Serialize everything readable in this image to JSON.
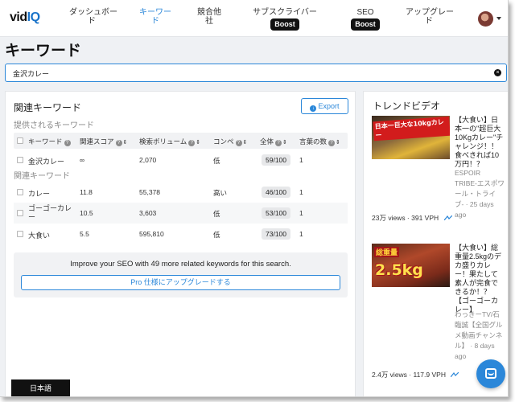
{
  "logo": {
    "vid": "vid",
    "iq": "IQ"
  },
  "nav": [
    {
      "label": "ダッシュボー\nド",
      "badge": null
    },
    {
      "label": "キーワー\nド",
      "badge": null,
      "active": true
    },
    {
      "label": "競合他\n社",
      "badge": null
    },
    {
      "label": "サブスクライバー",
      "badge": "Boost"
    },
    {
      "label": "SEO",
      "badge": "Boost"
    },
    {
      "label": "アップグレー\nド",
      "badge": null
    }
  ],
  "page": {
    "title": "キーワード"
  },
  "search": {
    "value": "金沢カレー",
    "clear_icon": "×"
  },
  "related": {
    "title": "関連キーワード",
    "export_label": "Export",
    "provided_label": "提供されるキーワード",
    "related_label": "関連キーワード",
    "columns": [
      "キーワード",
      "関連スコア",
      "検索ボリューム",
      "コンペ",
      "全体",
      "言葉の数"
    ],
    "provided_rows": [
      {
        "keyword": "金沢カレー",
        "score": "∞",
        "volume": "2,070",
        "comp": "低",
        "overall": "59/100",
        "words": "1"
      }
    ],
    "rows": [
      {
        "keyword": "カレー",
        "score": "11.8",
        "volume": "55,378",
        "comp": "高い",
        "overall": "46/100",
        "words": "1"
      },
      {
        "keyword": "ゴーゴーカレー",
        "score": "10.5",
        "volume": "3,603",
        "comp": "低",
        "overall": "53/100",
        "words": "1"
      },
      {
        "keyword": "大食い",
        "score": "5.5",
        "volume": "595,810",
        "comp": "低",
        "overall": "73/100",
        "words": "1"
      }
    ],
    "upgrade_text": "Improve your SEO with 49 more related keywords for this search.",
    "upgrade_button": "Pro 仕様にアップグレードする"
  },
  "language_button": "日本語",
  "trend": {
    "title": "トレンドビデオ",
    "videos": [
      {
        "thumb_text": "日本一巨大な10kgカレー",
        "title": "【大食い】日本一の\"超巨大10Kgカレー\"チャレンジ！！食べきれば10万円！？",
        "channel": "ESPOIR TRIBE-エスポワール・トライブ- · 25 days ago",
        "stats": "23万 views · 391 VPH"
      },
      {
        "thumb_text_a": "総重量",
        "thumb_text_b": "2.5kg",
        "title": "【大食い】総重量2.5kgのデカ盛りカレー！果たして素人が完食できるか！？【ゴーゴーカレー】",
        "channel": "わっきーTV/石臨誠【全国グルメ動画チャンネル】 · 8 days ago",
        "stats": "2.4万 views · 117.9 VPH"
      }
    ]
  },
  "colors": {
    "accent": "#2b87d9",
    "badge_bg": "#111111",
    "frame_bg": "#eff1f4"
  }
}
